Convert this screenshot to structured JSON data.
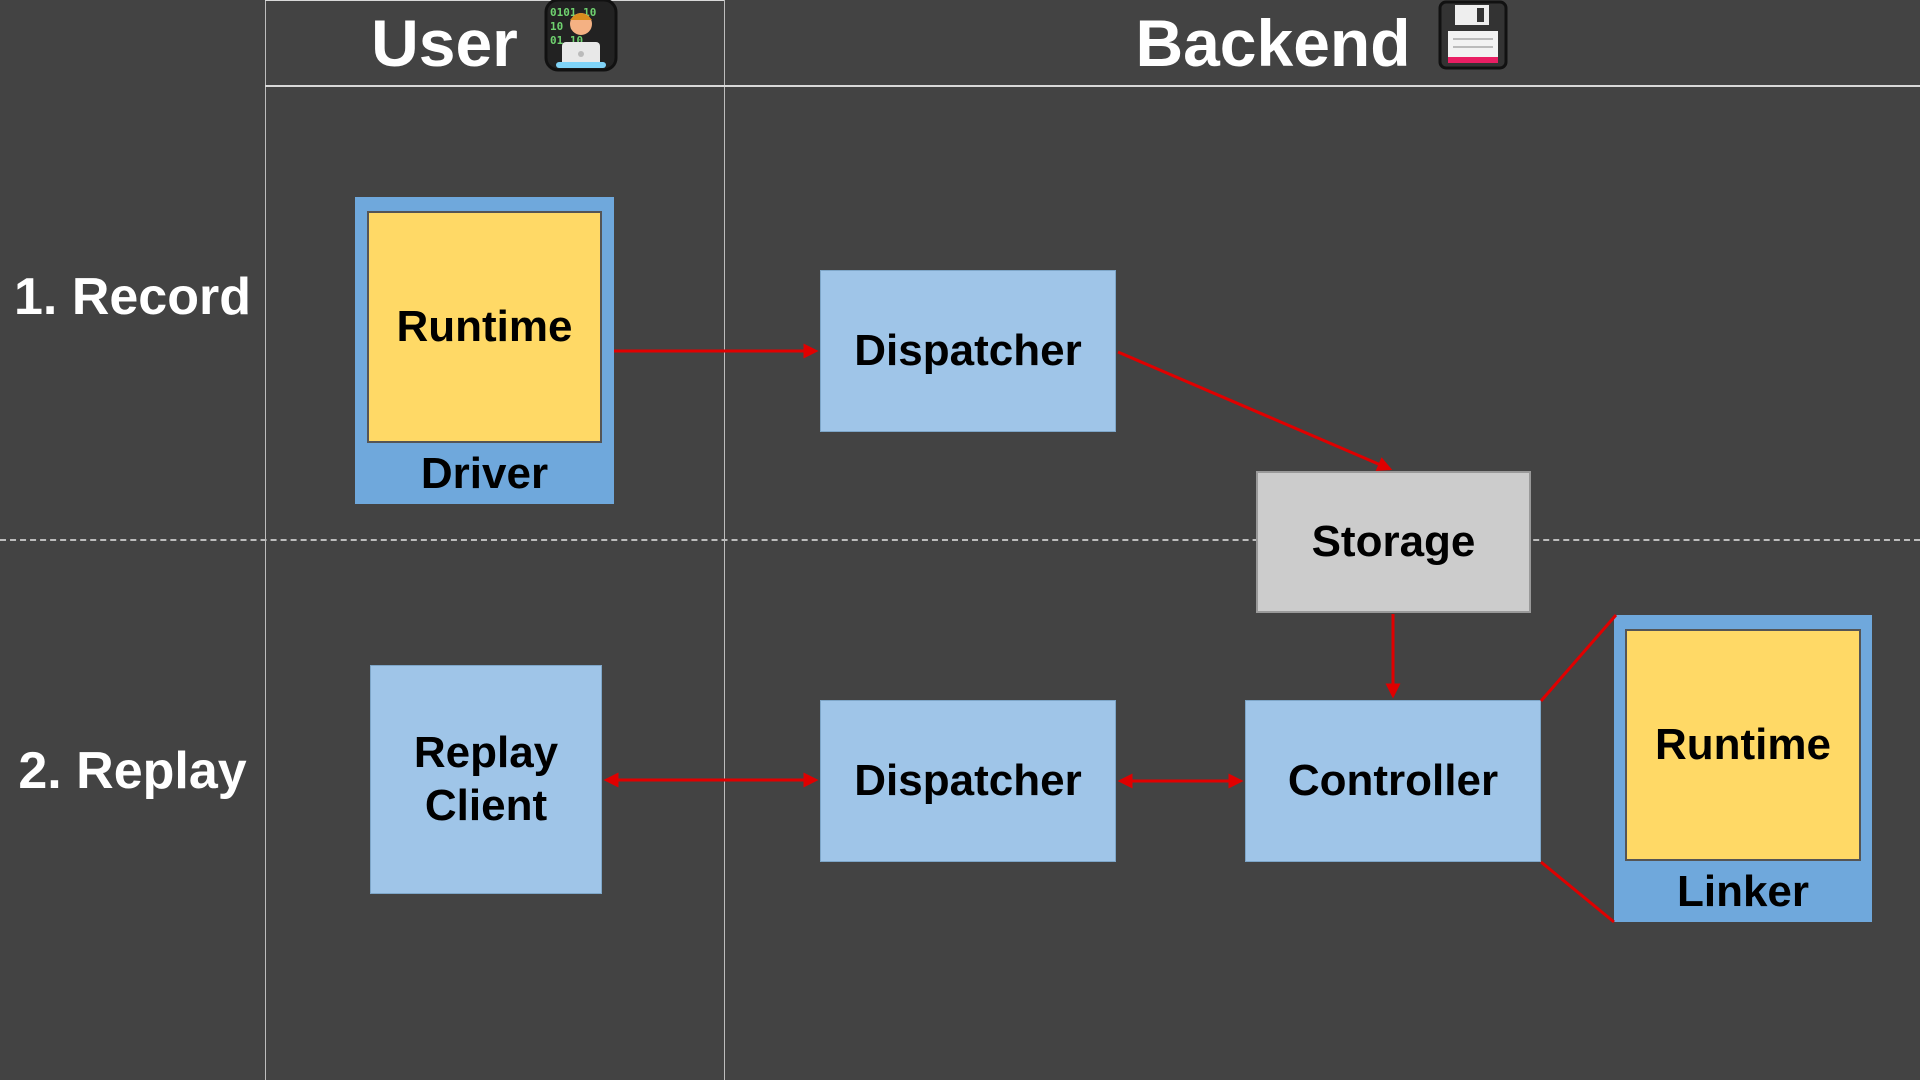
{
  "columns": {
    "user": {
      "title": "User",
      "icon": "technologist-icon"
    },
    "backend": {
      "title": "Backend",
      "icon": "floppy-disk-icon"
    }
  },
  "rows": {
    "record": "1. Record",
    "replay": "2. Replay"
  },
  "nodes": {
    "driver": {
      "label": "Driver",
      "inner": "Runtime"
    },
    "dispatcher_record": "Dispatcher",
    "storage": "Storage",
    "replay_client": "Replay Client",
    "dispatcher_replay": "Dispatcher",
    "controller": "Controller",
    "linker": {
      "label": "Linker",
      "inner": "Runtime"
    }
  },
  "colors": {
    "background": "#434343",
    "arrow": "#e00000",
    "box_blue": "#9fc5e8",
    "container_blue": "#6fa8dc",
    "runtime_yellow": "#ffd966",
    "storage_grey": "#cccccc"
  }
}
